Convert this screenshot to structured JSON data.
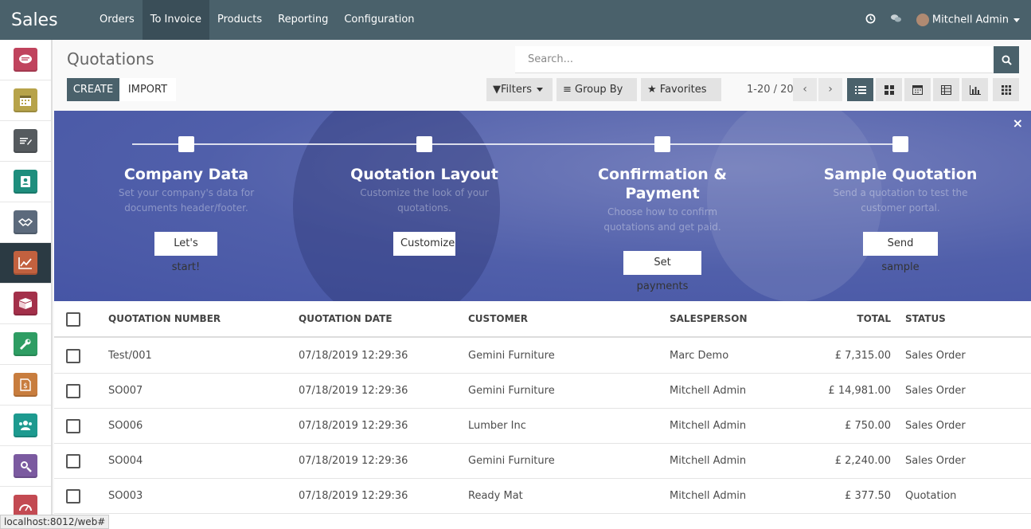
{
  "app": {
    "title": "Sales"
  },
  "nav": {
    "items": [
      "Orders",
      "To Invoice",
      "Products",
      "Reporting",
      "Configuration"
    ],
    "active": "To Invoice",
    "user": "Mitchell Admin"
  },
  "sidebar": {
    "apps": [
      {
        "icon": "discuss-icon",
        "color": "#c0435d"
      },
      {
        "icon": "calendar-icon",
        "color": "#b7a34a"
      },
      {
        "icon": "notes-icon",
        "color": "#555a5e"
      },
      {
        "icon": "contacts-icon",
        "color": "#1e8e7d"
      },
      {
        "icon": "crm-handshake-icon",
        "color": "#5c6a7c"
      },
      {
        "icon": "sales-chart-icon",
        "color": "#c2613f"
      },
      {
        "icon": "inventory-box-icon",
        "color": "#a3304a"
      },
      {
        "icon": "settings-wrench-icon",
        "color": "#2e9d63"
      },
      {
        "icon": "invoicing-icon",
        "color": "#c87d3e"
      },
      {
        "icon": "employees-icon",
        "color": "#1d9a8f"
      },
      {
        "icon": "search-magnifier-icon",
        "color": "#7b5aa0"
      },
      {
        "icon": "dashboard-icon",
        "color": "#c34a52"
      }
    ],
    "active_index": 5
  },
  "control_panel": {
    "title": "Quotations",
    "search_placeholder": "Search...",
    "create_label": "CREATE",
    "import_label": "IMPORT",
    "filters_label": "Filters",
    "groupby_label": "Group By",
    "favorites_label": "Favorites",
    "pager": "1-20 / 20"
  },
  "banner": {
    "steps": [
      {
        "title": "Company Data",
        "desc": "Set your company's data for documents header/footer.",
        "button": "Let's start!"
      },
      {
        "title": "Quotation Layout",
        "desc": "Customize the look of your quotations.",
        "button": "Customize"
      },
      {
        "title": "Confirmation & Payment",
        "desc": "Choose how to confirm quotations and get paid.",
        "button": "Set payments"
      },
      {
        "title": "Sample Quotation",
        "desc": "Send a quotation to test the customer portal.",
        "button": "Send sample"
      }
    ],
    "close": "×"
  },
  "table": {
    "headers": [
      "QUOTATION NUMBER",
      "QUOTATION DATE",
      "CUSTOMER",
      "SALESPERSON",
      "TOTAL",
      "STATUS"
    ],
    "rows": [
      {
        "number": "Test/001",
        "date": "07/18/2019 12:29:36",
        "customer": "Gemini Furniture",
        "salesperson": "Marc Demo",
        "total": "£ 7,315.00",
        "status": "Sales Order"
      },
      {
        "number": "SO007",
        "date": "07/18/2019 12:29:36",
        "customer": "Gemini Furniture",
        "salesperson": "Mitchell Admin",
        "total": "£ 14,981.00",
        "status": "Sales Order"
      },
      {
        "number": "SO006",
        "date": "07/18/2019 12:29:36",
        "customer": "Lumber Inc",
        "salesperson": "Mitchell Admin",
        "total": "£ 750.00",
        "status": "Sales Order"
      },
      {
        "number": "SO004",
        "date": "07/18/2019 12:29:36",
        "customer": "Gemini Furniture",
        "salesperson": "Mitchell Admin",
        "total": "£ 2,240.00",
        "status": "Sales Order"
      },
      {
        "number": "SO003",
        "date": "07/18/2019 12:29:36",
        "customer": "Ready Mat",
        "salesperson": "Mitchell Admin",
        "total": "£ 377.50",
        "status": "Quotation"
      }
    ]
  },
  "status_bar": {
    "url": "localhost:8012/web#"
  }
}
